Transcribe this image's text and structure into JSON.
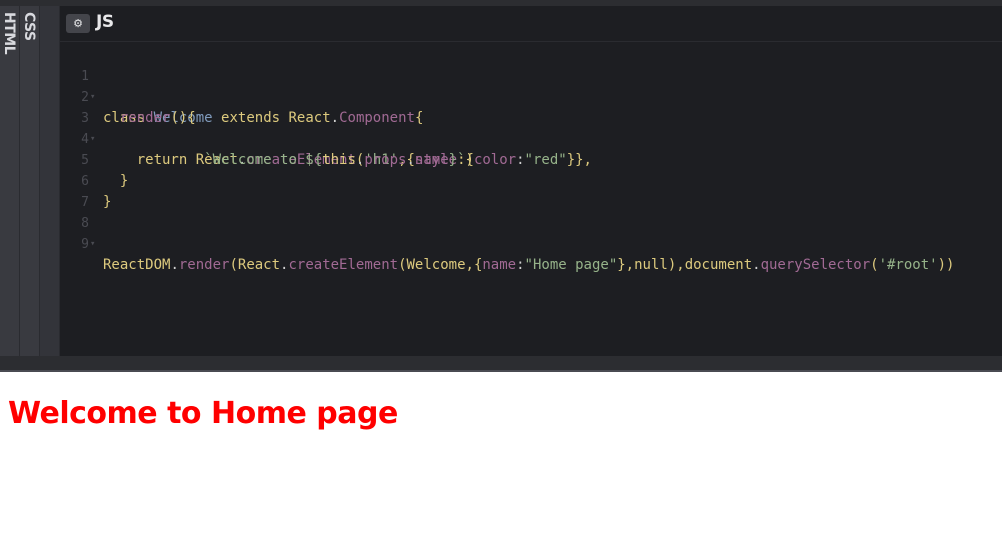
{
  "tabs": {
    "html_label": "HTML",
    "css_label": "CSS"
  },
  "js_panel": {
    "title": "JS",
    "settings_icon": "gear-icon"
  },
  "code_lines": [
    {
      "num": "1",
      "fold": true
    },
    {
      "num": "2",
      "fold": false
    },
    {
      "num": "3",
      "fold": true
    },
    {
      "num": "4",
      "fold": false
    },
    {
      "num": "5",
      "fold": false
    },
    {
      "num": "6",
      "fold": false
    },
    {
      "num": "7",
      "fold": false
    },
    {
      "num": "8",
      "fold": true
    },
    {
      "num": "9",
      "fold": false
    }
  ],
  "code": {
    "l1": [
      "class",
      " ",
      "Welcome",
      " ",
      "extends",
      " ",
      "React",
      ".",
      "Component",
      "{"
    ],
    "l2": [
      "  ",
      "render",
      "(){"
    ],
    "l3": [
      "    ",
      "return",
      " ",
      "React",
      ".",
      "createElement",
      "(",
      "'h1'",
      ",{",
      "style",
      ":{",
      "color",
      ":",
      "\"red\"",
      "}},"
    ],
    "l4": [
      "            ",
      "`Welcome to ${",
      "this",
      ".",
      "props",
      ".",
      "name",
      "}`",
      ")"
    ],
    "l5": [
      "  ",
      "}"
    ],
    "l6": [
      "}"
    ],
    "l8": [
      "ReactDOM",
      ".",
      "render",
      "(",
      "React",
      ".",
      "createElement",
      "(",
      "Welcome",
      ",{",
      "name",
      ":",
      "\"Home page\"",
      "},",
      "null",
      "),",
      "document",
      ".",
      "querySelector",
      "(",
      "'#root'",
      "))"
    ]
  },
  "output": {
    "heading": "Welcome to Home page"
  },
  "colors": {
    "keyword": "#ddca7e",
    "function": "#a16a94",
    "class": "#809bbd",
    "string": "#96b38a",
    "heading": "#ff0000"
  }
}
